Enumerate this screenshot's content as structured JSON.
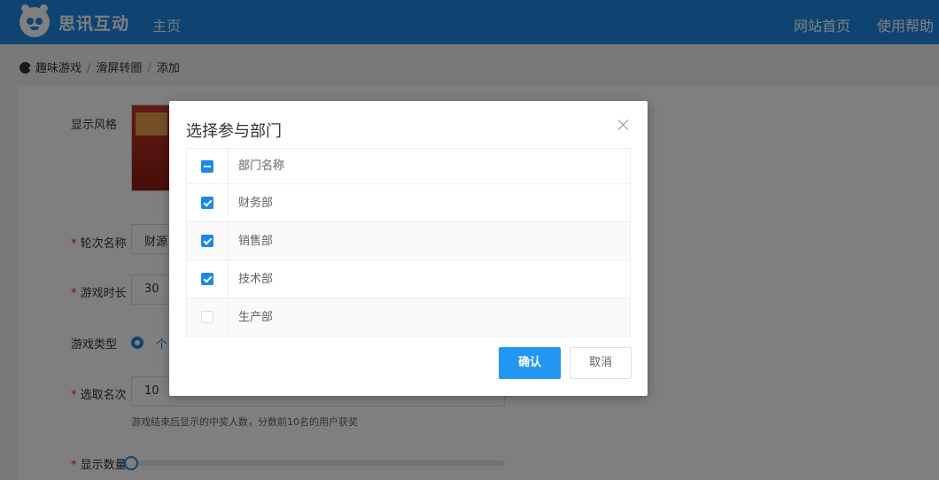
{
  "header": {
    "brand": "思讯互动",
    "home": "主页",
    "site_home": "网站首页",
    "help": "使用帮助"
  },
  "breadcrumb": {
    "items": [
      "趣味游戏",
      "滑屏转圈",
      "添加"
    ],
    "separator": "/"
  },
  "form": {
    "style_label": "显示风格",
    "round_name_label": "轮次名称",
    "round_name_value": "财源",
    "duration_label": "游戏时长",
    "duration_value": "30",
    "type_label": "游戏类型",
    "type_option": "个",
    "pick_label": "选取名次",
    "pick_value": "10",
    "pick_hint": "游戏结束后显示的中奖人数，分数前10名的用户获奖",
    "show_count_label": "显示数量",
    "show_count_value": 0
  },
  "dialog": {
    "title": "选择参与部门",
    "column_header": "部门名称",
    "rows": [
      {
        "name": "财务部",
        "checked": true
      },
      {
        "name": "销售部",
        "checked": true
      },
      {
        "name": "技术部",
        "checked": true
      },
      {
        "name": "生产部",
        "checked": false
      }
    ],
    "confirm": "确认",
    "cancel": "取消"
  },
  "colors": {
    "primary": "#1e88e5",
    "button": "#2196f3",
    "required": "#f5222d"
  }
}
